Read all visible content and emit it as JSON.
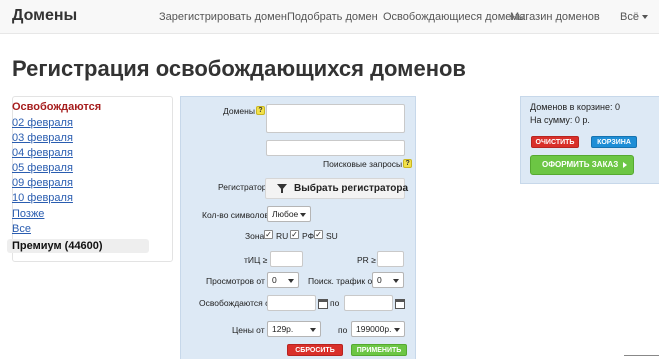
{
  "navbar": {
    "brand": "Домены",
    "links": [
      "Зарегистрировать домен",
      "Подобрать домен",
      "Освобождающиеся домены",
      "Магазин доменов",
      "Всё"
    ]
  },
  "page_title": "Регистрация освобождающихся доменов",
  "sidebar": {
    "heading": "Освобождаются",
    "links": [
      "02 февраля",
      "03 февраля",
      "04 февраля",
      "05 февраля",
      "09 февраля",
      "10 февраля",
      "Позже",
      "Все"
    ],
    "active": "Премиум (44600)"
  },
  "filter": {
    "domains_label": "Домены",
    "search_queries_label": "Поисковые запросы",
    "registrar_label": "Регистратор",
    "registrar_button": "Выбрать регистратора",
    "chars_label": "Кол-во символов",
    "chars_value": "Любое",
    "zone_label": "Зона",
    "zones": [
      {
        "name": "RU",
        "checked": true
      },
      {
        "name": "РФ",
        "checked": true
      },
      {
        "name": "SU",
        "checked": true
      }
    ],
    "tic_label": "тИЦ ≥",
    "pr_label": "PR ≥",
    "views_label": "Просмотров от",
    "views_value": "0",
    "traffic_label": "Поиск. трафик от",
    "traffic_value": "0",
    "release_label": "Освобождаются с",
    "release_to_label": "по",
    "price_label": "Цены от",
    "price_from": "129р.",
    "price_to_label": "по",
    "price_to": "199000р.",
    "reset_button": "СБРОСИТЬ",
    "apply_button": "ПРИМЕНИТЬ",
    "help_glyph": "?",
    "check_glyph": "✓"
  },
  "cart": {
    "count_label": "Доменов в корзине: 0",
    "sum_label": "На сумму:  0 р.",
    "clear_button": "ОЧИСТИТЬ",
    "cart_button": "КОРЗИНА",
    "order_button": "ОФОРМИТЬ ЗАКАЗ"
  },
  "colors": {
    "accent_red": "#d9302a",
    "accent_blue": "#1e8ed6",
    "accent_green": "#6cc644",
    "link": "#2a5db0",
    "heading_red": "#a61d1d",
    "panel": "#dde9f5"
  }
}
